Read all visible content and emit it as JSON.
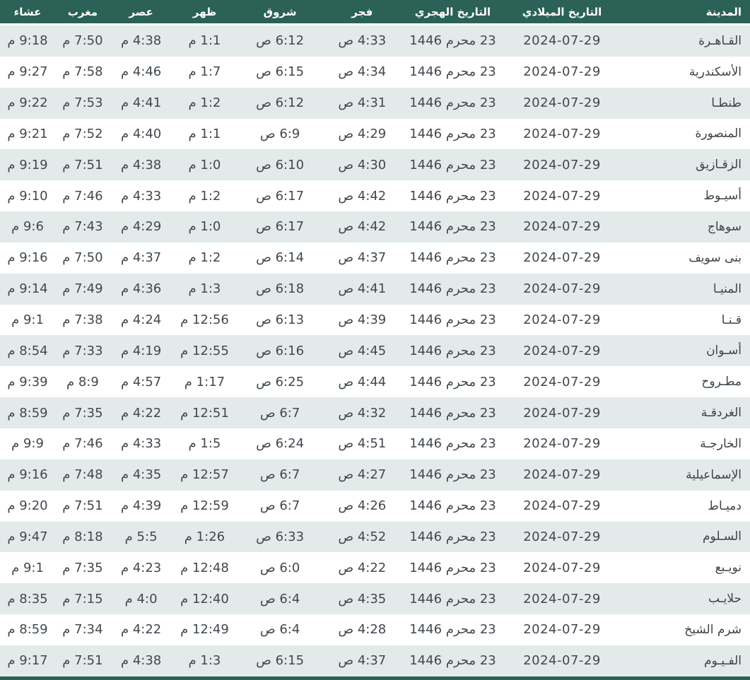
{
  "colors": {
    "header_bg": "#2b6156",
    "header_text": "#ffffff",
    "stripe_row_bg": "#e3eaea",
    "plain_row_bg": "#ffffff",
    "cell_text": "#41484f",
    "bottom_bar": "#2b6156"
  },
  "table": {
    "columns": [
      {
        "key": "city",
        "label": "المدينة"
      },
      {
        "key": "gregorian",
        "label": "التاريخ الميلادي"
      },
      {
        "key": "hijri",
        "label": "التاريخ الهجري"
      },
      {
        "key": "fajr",
        "label": "فجر"
      },
      {
        "key": "shuruq",
        "label": "شروق"
      },
      {
        "key": "dhuhr",
        "label": "ظهر"
      },
      {
        "key": "asr",
        "label": "عصر"
      },
      {
        "key": "maghrib",
        "label": "مغرب"
      },
      {
        "key": "isha",
        "label": "عشاء"
      }
    ],
    "rows": [
      {
        "city": "القـاهـرة",
        "gregorian": "2024-07-29",
        "hijri": "23 محرم 1446",
        "fajr": "4:33 ص",
        "shuruq": "6:12 ص",
        "dhuhr": "1:1 م",
        "asr": "4:38 م",
        "maghrib": "7:50 م",
        "isha": "9:18 م"
      },
      {
        "city": "الأسكندرية",
        "gregorian": "2024-07-29",
        "hijri": "23 محرم 1446",
        "fajr": "4:34 ص",
        "shuruq": "6:15 ص",
        "dhuhr": "1:7 م",
        "asr": "4:46 م",
        "maghrib": "7:58 م",
        "isha": "9:27 م"
      },
      {
        "city": "طنطـا",
        "gregorian": "2024-07-29",
        "hijri": "23 محرم 1446",
        "fajr": "4:31 ص",
        "shuruq": "6:12 ص",
        "dhuhr": "1:2 م",
        "asr": "4:41 م",
        "maghrib": "7:53 م",
        "isha": "9:22 م"
      },
      {
        "city": "المنصورة",
        "gregorian": "2024-07-29",
        "hijri": "23 محرم 1446",
        "fajr": "4:29 ص",
        "shuruq": "6:9 ص",
        "dhuhr": "1:1 م",
        "asr": "4:40 م",
        "maghrib": "7:52 م",
        "isha": "9:21 م"
      },
      {
        "city": "الزقـازيق",
        "gregorian": "2024-07-29",
        "hijri": "23 محرم 1446",
        "fajr": "4:30 ص",
        "shuruq": "6:10 ص",
        "dhuhr": "1:0 م",
        "asr": "4:38 م",
        "maghrib": "7:51 م",
        "isha": "9:19 م"
      },
      {
        "city": "أسيـوط",
        "gregorian": "2024-07-29",
        "hijri": "23 محرم 1446",
        "fajr": "4:42 ص",
        "shuruq": "6:17 ص",
        "dhuhr": "1:2 م",
        "asr": "4:33 م",
        "maghrib": "7:46 م",
        "isha": "9:10 م"
      },
      {
        "city": "سوهاج",
        "gregorian": "2024-07-29",
        "hijri": "23 محرم 1446",
        "fajr": "4:42 ص",
        "shuruq": "6:17 ص",
        "dhuhr": "1:0 م",
        "asr": "4:29 م",
        "maghrib": "7:43 م",
        "isha": "9:6 م"
      },
      {
        "city": "بنى سويف",
        "gregorian": "2024-07-29",
        "hijri": "23 محرم 1446",
        "fajr": "4:37 ص",
        "shuruq": "6:14 ص",
        "dhuhr": "1:2 م",
        "asr": "4:37 م",
        "maghrib": "7:50 م",
        "isha": "9:16 م"
      },
      {
        "city": "المنيـا",
        "gregorian": "2024-07-29",
        "hijri": "23 محرم 1446",
        "fajr": "4:41 ص",
        "shuruq": "6:18 ص",
        "dhuhr": "1:3 م",
        "asr": "4:36 م",
        "maghrib": "7:49 م",
        "isha": "9:14 م"
      },
      {
        "city": "قـنـا",
        "gregorian": "2024-07-29",
        "hijri": "23 محرم 1446",
        "fajr": "4:39 ص",
        "shuruq": "6:13 ص",
        "dhuhr": "12:56 م",
        "asr": "4:24 م",
        "maghrib": "7:38 م",
        "isha": "9:1 م"
      },
      {
        "city": "أسـوان",
        "gregorian": "2024-07-29",
        "hijri": "23 محرم 1446",
        "fajr": "4:45 ص",
        "shuruq": "6:16 ص",
        "dhuhr": "12:55 م",
        "asr": "4:19 م",
        "maghrib": "7:33 م",
        "isha": "8:54 م"
      },
      {
        "city": "مطـروح",
        "gregorian": "2024-07-29",
        "hijri": "23 محرم 1446",
        "fajr": "4:44 ص",
        "shuruq": "6:25 ص",
        "dhuhr": "1:17 م",
        "asr": "4:57 م",
        "maghrib": "8:9 م",
        "isha": "9:39 م"
      },
      {
        "city": "الغردقـة",
        "gregorian": "2024-07-29",
        "hijri": "23 محرم 1446",
        "fajr": "4:32 ص",
        "shuruq": "6:7 ص",
        "dhuhr": "12:51 م",
        "asr": "4:22 م",
        "maghrib": "7:35 م",
        "isha": "8:59 م"
      },
      {
        "city": "الخارجـة",
        "gregorian": "2024-07-29",
        "hijri": "23 محرم 1446",
        "fajr": "4:51 ص",
        "shuruq": "6:24 ص",
        "dhuhr": "1:5 م",
        "asr": "4:33 م",
        "maghrib": "7:46 م",
        "isha": "9:9 م"
      },
      {
        "city": "الإسماعيلية",
        "gregorian": "2024-07-29",
        "hijri": "23 محرم 1446",
        "fajr": "4:27 ص",
        "shuruq": "6:7 ص",
        "dhuhr": "12:57 م",
        "asr": "4:35 م",
        "maghrib": "7:48 م",
        "isha": "9:16 م"
      },
      {
        "city": "دميـاط",
        "gregorian": "2024-07-29",
        "hijri": "23 محرم 1446",
        "fajr": "4:26 ص",
        "shuruq": "6:7 ص",
        "dhuhr": "12:59 م",
        "asr": "4:39 م",
        "maghrib": "7:51 م",
        "isha": "9:20 م"
      },
      {
        "city": "السـلوم",
        "gregorian": "2024-07-29",
        "hijri": "23 محرم 1446",
        "fajr": "4:52 ص",
        "shuruq": "6:33 ص",
        "dhuhr": "1:26 م",
        "asr": "5:5 م",
        "maghrib": "8:18 م",
        "isha": "9:47 م"
      },
      {
        "city": "نويـبع",
        "gregorian": "2024-07-29",
        "hijri": "23 محرم 1446",
        "fajr": "4:22 ص",
        "shuruq": "6:0 ص",
        "dhuhr": "12:48 م",
        "asr": "4:23 م",
        "maghrib": "7:35 م",
        "isha": "9:1 م"
      },
      {
        "city": "حلايـب",
        "gregorian": "2024-07-29",
        "hijri": "23 محرم 1446",
        "fajr": "4:35 ص",
        "shuruq": "6:4 ص",
        "dhuhr": "12:40 م",
        "asr": "4:0 م",
        "maghrib": "7:15 م",
        "isha": "8:35 م"
      },
      {
        "city": "شرم الشيخ",
        "gregorian": "2024-07-29",
        "hijri": "23 محرم 1446",
        "fajr": "4:28 ص",
        "shuruq": "6:4 ص",
        "dhuhr": "12:49 م",
        "asr": "4:22 م",
        "maghrib": "7:34 م",
        "isha": "8:59 م"
      },
      {
        "city": "الفـيـوم",
        "gregorian": "2024-07-29",
        "hijri": "23 محرم 1446",
        "fajr": "4:37 ص",
        "shuruq": "6:15 ص",
        "dhuhr": "1:3 م",
        "asr": "4:38 م",
        "maghrib": "7:51 م",
        "isha": "9:17 م"
      }
    ]
  }
}
